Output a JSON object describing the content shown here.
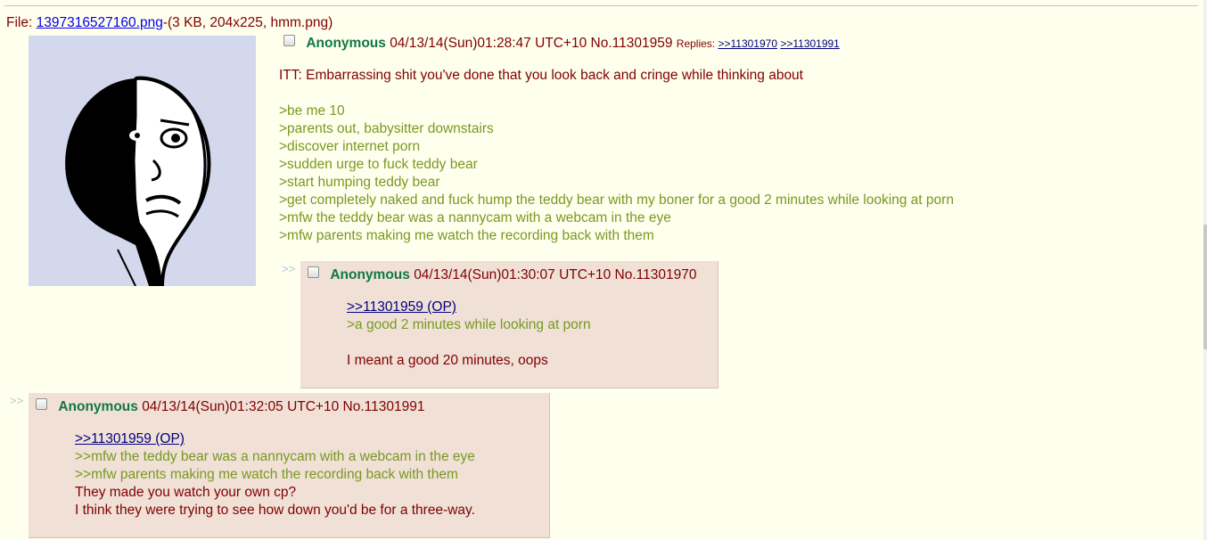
{
  "file": {
    "prefix": "File: ",
    "filename": "1397316527160.png",
    "meta": "-(3 KB, 204x225, hmm.png)"
  },
  "op": {
    "name": "Anonymous",
    "datetime": "04/13/14(Sun)01:28:47 UTC+10",
    "no": "No.11301959",
    "replies_label": "Replies:",
    "replies": [
      ">>11301970",
      ">>11301991"
    ],
    "subject_line": "ITT: Embarrassing shit you've done that you look back and cringe while thinking about",
    "lines": [
      ">be me 10",
      ">parents out, babysitter downstairs",
      ">discover internet porn",
      ">sudden urge to fuck teddy bear",
      ">start humping teddy bear",
      ">get completely naked and fuck hump the teddy bear with my boner for a good 2 minutes while looking at porn",
      ">mfw the teddy bear was a nannycam with a webcam in the eye",
      ">mfw parents making me watch the recording back with them"
    ]
  },
  "reply1": {
    "arrows": ">>",
    "name": "Anonymous",
    "datetime": "04/13/14(Sun)01:30:07 UTC+10",
    "no": "No.11301970",
    "quote_link": ">>11301959 (OP)",
    "green": ">a good 2 minutes while looking at porn",
    "text": "I meant a good 20 minutes, oops"
  },
  "reply2": {
    "arrows": ">>",
    "name": "Anonymous",
    "datetime": "04/13/14(Sun)01:32:05 UTC+10",
    "no": "No.11301991",
    "quote_link": ">>11301959 (OP)",
    "green1": ">>mfw the teddy bear was a nannycam with a webcam in the eye",
    "green2": ">>mfw parents making me watch the recording back with them",
    "text1": "They made you watch your own cp?",
    "text2": "I think they were trying to see how down you'd be for a three-way."
  }
}
